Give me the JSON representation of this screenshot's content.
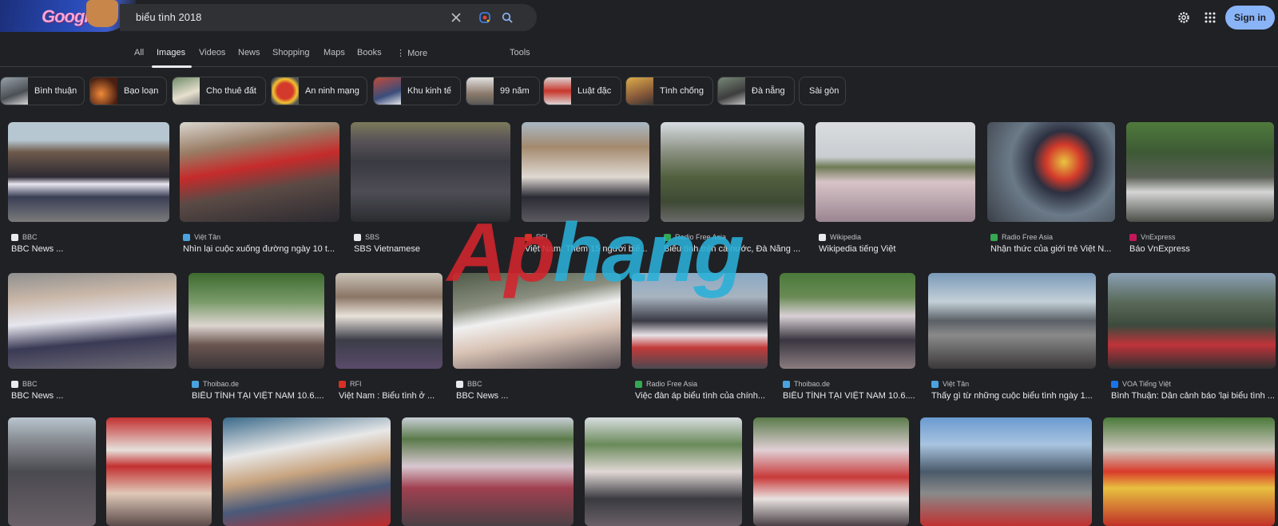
{
  "header": {
    "doodle_text": "Google",
    "search_query": "biểu tình 2018",
    "sign_in_label": "Sign in"
  },
  "tabs": [
    "All",
    "Images",
    "Videos",
    "News",
    "Shopping",
    "Maps",
    "Books",
    "More",
    "Tools"
  ],
  "chips": [
    "Bình thuận",
    "Bạo loạn",
    "Cho thuê đất",
    "An ninh mạng",
    "Khu kinh tế",
    "99 năm",
    "Luật đặc",
    "Tình chống",
    "Đà nẵng",
    "Sài gòn"
  ],
  "results": [
    {
      "source": "BBC",
      "caption": "BBC News ..."
    },
    {
      "source": "Việt Tân",
      "caption": "Nhìn lại cuộc xuống đường ngày 10 t..."
    },
    {
      "source": "SBS",
      "caption": "SBS Vietnamese"
    },
    {
      "source": "RFI",
      "caption": "Việt Nam: Thêm 15 người biể..."
    },
    {
      "source": "Radio Free Asia",
      "caption": "Biểu tình trên cả nước, Đà Nẵng ..."
    },
    {
      "source": "Wikipedia",
      "caption": "Wikipedia tiếng Việt"
    },
    {
      "source": "Radio Free Asia",
      "caption": "Nhận thức của giới trẻ Việt N..."
    },
    {
      "source": "VnExpress",
      "caption": "Báo VnExpress"
    },
    {
      "source": "BBC",
      "caption": "BBC News ..."
    },
    {
      "source": "Thoibao.de",
      "caption": "BIỂU TÌNH TẠI VIỆT NAM 10.6...."
    },
    {
      "source": "RFI",
      "caption": "Việt Nam : Biểu tình ở ..."
    },
    {
      "source": "BBC",
      "caption": "BBC News ..."
    },
    {
      "source": "Radio Free Asia",
      "caption": "Việc đàn áp biểu tình của chính..."
    },
    {
      "source": "Thoibao.de",
      "caption": "BIỂU TÌNH TẠI VIỆT NAM 10.6...."
    },
    {
      "source": "Việt Tân",
      "caption": "Thấy gì từ những cuộc biểu tình ngày 1..."
    },
    {
      "source": "VOA Tiếng Việt",
      "caption": "Bình Thuận: Dân cảnh báo 'lại biểu tình ..."
    }
  ],
  "watermark": {
    "part1": "Ap",
    "part2": "hang"
  },
  "colors": {
    "background": "#202124",
    "accent": "#8ab4f8",
    "searchbox": "#303134"
  }
}
